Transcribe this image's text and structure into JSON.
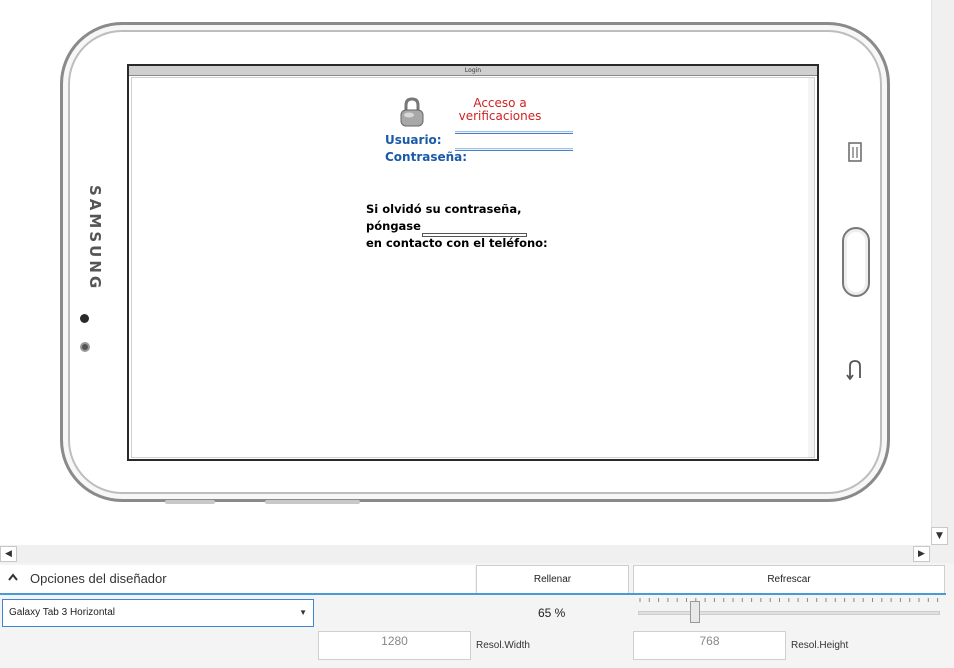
{
  "tablet": {
    "brand": "SAMSUNG",
    "screen": {
      "window_title": "Login",
      "login_title": "Acceso a verificaciones",
      "user_label": "Usuario:",
      "password_label": "Contraseña:",
      "forgot_line1": "Si olvidó su contraseña, póngase",
      "forgot_line2": "en contacto con el teléfono:"
    }
  },
  "designer": {
    "options_label": "Opciones del diseñador",
    "fill_button": "Rellenar",
    "refresh_button": "Refrescar",
    "device_selected": "Galaxy Tab 3 Horizontal",
    "zoom": "65 %",
    "zoom_value": 65,
    "res_width_value": "1280",
    "res_width_label": "Resol.Width",
    "res_height_value": "768",
    "res_height_label": "Resol.Height"
  },
  "colors": {
    "accent": "#4a9ad8",
    "label_blue": "#1a5aa8",
    "title_red": "#d02020"
  }
}
